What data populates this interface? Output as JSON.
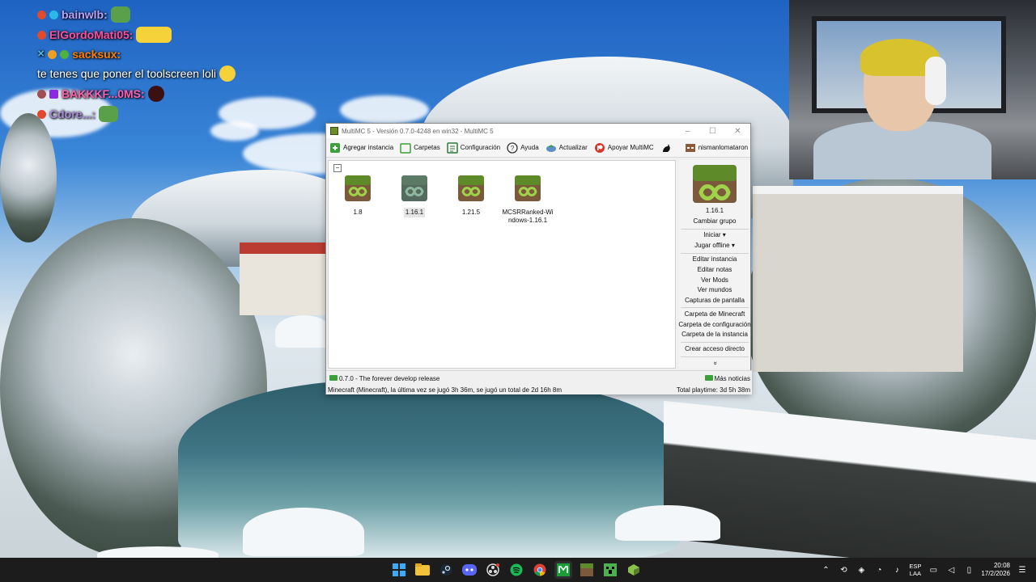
{
  "chat": [
    {
      "user": "bainwlb:",
      "message": "",
      "user_color": "#b9a3ff"
    },
    {
      "user": "ElGordoMati05:",
      "message": "",
      "user_color": "#ff4f9a"
    },
    {
      "user": "sacksux:",
      "message": "te tenes que poner el toolscreen loli",
      "user_color": "#ff7f00"
    },
    {
      "user": "BAKKKF...0MS:",
      "message": "",
      "user_color": "#ff5fb0"
    },
    {
      "user": "Cdore...:",
      "message": "",
      "user_color": "#a88bd8"
    }
  ],
  "multimc": {
    "title": "MultiMC 5 - Versión 0.7.0-4248 en win32 - MultiMC 5",
    "toolbar": {
      "add_instance": "Agregar instancia",
      "folders": "Carpetas",
      "settings": "Configuración",
      "help": "Ayuda",
      "update": "Actualizar",
      "support": "Apoyar MultiMC",
      "account": "nismanlomataron"
    },
    "instances": [
      {
        "label": "1.8"
      },
      {
        "label": "1.16.1"
      },
      {
        "label": "1.21.5"
      },
      {
        "label": "MCSRRanked-Windows-1.16.1"
      }
    ],
    "side": {
      "selected_name": "1.16.1",
      "change_group": "Cambiar grupo",
      "launch": "Iniciar",
      "launch_offline": "Jugar offline",
      "edit_instance": "Editar instancia",
      "edit_notes": "Editar notas",
      "view_mods": "Ver Mods",
      "view_worlds": "Ver mundos",
      "screenshots": "Capturas de pantalla",
      "minecraft_folder": "Carpeta de Minecraft",
      "config_folder": "Carpeta de configuración",
      "instance_folder": "Carpeta de la instancia",
      "create_shortcut": "Crear acceso directo",
      "more": "»"
    },
    "status": {
      "news": "0.7.0 - The forever develop release",
      "more_news": "Más noticias",
      "playtime": "Minecraft (Minecraft), la última vez se jugó 3h 36m, se jugó un total de 2d 16h 8m",
      "total_playtime": "Total playtime: 3d 5h 38m"
    },
    "colors": {
      "grass_green": "#5f8a2a",
      "dirt_brown": "#7a5a3a",
      "accent_green": "#7fb82a"
    }
  },
  "taskbar": {
    "apps": [
      "windows-start-icon",
      "file-explorer-icon",
      "steam-icon",
      "discord-icon",
      "obs-icon",
      "spotify-icon",
      "chrome-icon",
      "multimc-icon",
      "minecraft-grass-icon",
      "minecraft-creeper-icon",
      "minecraft-launcher-icon"
    ],
    "lang_top": "ESP",
    "lang_bottom": "LAA",
    "time": "20:08",
    "date": "17/2/2026"
  }
}
